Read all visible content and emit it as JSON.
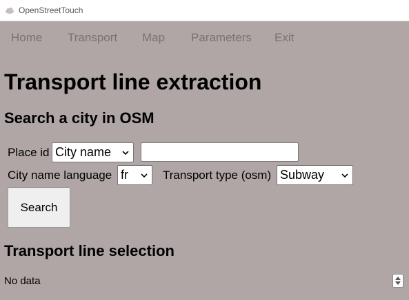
{
  "window": {
    "title": "OpenStreetTouch",
    "icon": "app-cloud-icon"
  },
  "menu": {
    "items": [
      {
        "label": "Home"
      },
      {
        "label": "Transport"
      },
      {
        "label": "Map"
      },
      {
        "label": "Parameters"
      },
      {
        "label": "Exit"
      }
    ]
  },
  "page": {
    "title": "Transport line extraction",
    "search_section": {
      "heading": "Search a city in OSM",
      "place_id_label": "Place id",
      "place_id_type": "City name",
      "city_name_value": "",
      "language_label": "City name language",
      "language_value": "fr",
      "transport_type_label": "Transport type (osm)",
      "transport_type_value": "Subway",
      "search_button": "Search"
    },
    "selection_section": {
      "heading": "Transport line selection",
      "empty_text": "No data"
    }
  }
}
